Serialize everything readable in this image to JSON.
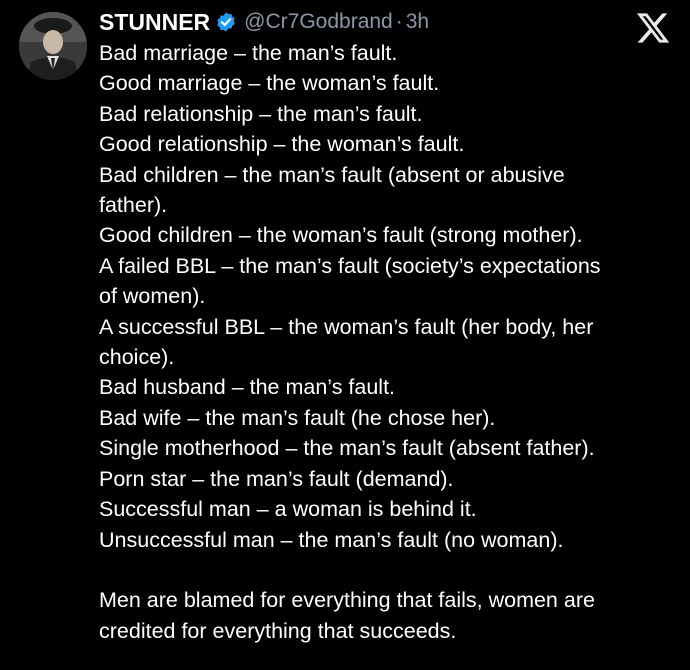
{
  "author": {
    "name": "STUNNER",
    "handle": "@Cr7Godbrand",
    "separator": "·",
    "time": "3h"
  },
  "icons": {
    "verified": "verified-badge-icon",
    "platform_logo": "x-logo-icon"
  },
  "colors": {
    "background": "#000000",
    "text": "#ffffff",
    "muted": "#8b98a5",
    "verified": "#1d9bf0"
  },
  "tweet": {
    "lines": [
      "Bad marriage – the man’s fault.",
      "Good marriage – the woman’s fault.",
      "Bad relationship – the man’s fault.",
      "Good relationship – the woman’s fault.",
      "Bad children – the man’s fault (absent or abusive",
      "father).",
      "Good children – the woman’s fault (strong mother).",
      "A failed BBL – the man’s fault (society’s expectations",
      "of women).",
      "A successful BBL – the woman’s fault (her body, her",
      "choice).",
      "Bad husband – the man’s fault.",
      "Bad wife – the man’s fault (he chose her).",
      "Single motherhood – the man’s fault (absent father).",
      "Porn star – the man’s fault (demand).",
      "Successful man – a woman is behind it.",
      "Unsuccessful man – the man’s fault (no woman)."
    ],
    "closing": [
      "Men  are blamed for everything that fails, women are",
      "credited for everything that succeeds."
    ]
  }
}
